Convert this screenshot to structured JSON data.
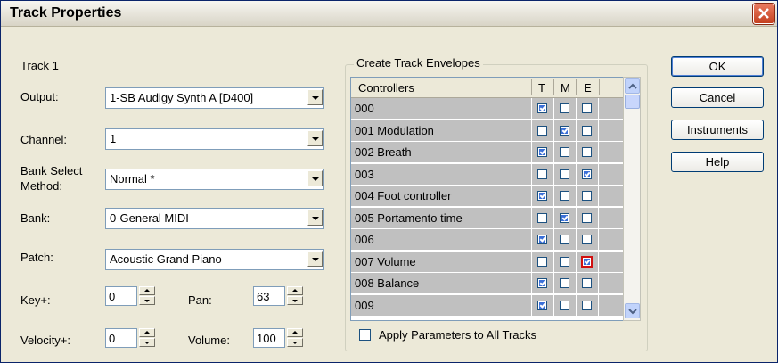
{
  "window": {
    "title": "Track Properties"
  },
  "track": {
    "label": "Track 1"
  },
  "fields": {
    "output": {
      "label": "Output:",
      "value": "1-SB Audigy Synth A [D400]"
    },
    "channel": {
      "label": "Channel:",
      "value": "1"
    },
    "bank_select": {
      "label_line1": "Bank Select",
      "label_line2": "Method:",
      "value": "Normal *"
    },
    "bank": {
      "label": "Bank:",
      "value": "0-General MIDI"
    },
    "patch": {
      "label": "Patch:",
      "value": "Acoustic Grand Piano"
    },
    "key": {
      "label": "Key+:",
      "value": "0"
    },
    "pan": {
      "label": "Pan:",
      "value": "63"
    },
    "velocity": {
      "label": "Velocity+:",
      "value": "0"
    },
    "volume": {
      "label": "Volume:",
      "value": "100"
    }
  },
  "envelopes": {
    "group_title": "Create Track Envelopes",
    "columns": {
      "controllers": "Controllers",
      "t": "T",
      "m": "M",
      "e": "E"
    },
    "rows": [
      {
        "label": "000",
        "t": true,
        "m": false,
        "e": false
      },
      {
        "label": "001  Modulation",
        "t": false,
        "m": true,
        "e": false
      },
      {
        "label": "002  Breath",
        "t": true,
        "m": false,
        "e": false
      },
      {
        "label": "003",
        "t": false,
        "m": false,
        "e": true
      },
      {
        "label": "004  Foot controller",
        "t": true,
        "m": false,
        "e": false
      },
      {
        "label": "005  Portamento time",
        "t": false,
        "m": true,
        "e": false
      },
      {
        "label": "006",
        "t": true,
        "m": false,
        "e": false
      },
      {
        "label": "007  Volume",
        "t": false,
        "m": false,
        "e": true
      },
      {
        "label": "008  Balance",
        "t": true,
        "m": false,
        "e": false
      },
      {
        "label": "009",
        "t": true,
        "m": false,
        "e": false
      }
    ],
    "apply_all_label": "Apply Parameters to All Tracks"
  },
  "buttons": {
    "ok": "OK",
    "cancel": "Cancel",
    "instruments": "Instruments",
    "help": "Help"
  }
}
